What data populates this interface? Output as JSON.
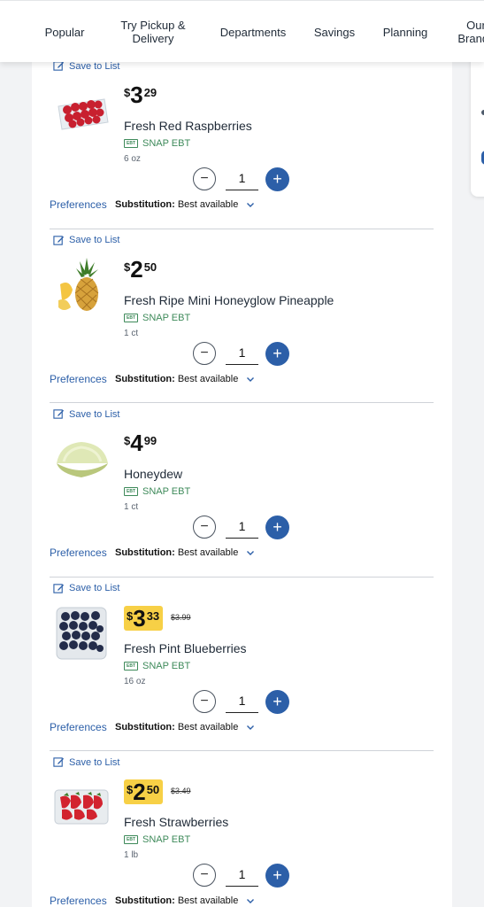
{
  "nav": {
    "items": [
      "Popular",
      "Try Pickup &\nDelivery",
      "Departments",
      "Savings",
      "Planning",
      "Our\nBrands"
    ]
  },
  "common": {
    "save_label": "Save to List",
    "snap_label": "SNAP EBT",
    "ebt_badge": "EBT",
    "preferences_label": "Preferences",
    "substitution_label": "Substitution:",
    "substitution_value": "Best available",
    "minus": "−",
    "plus": "+"
  },
  "colors": {
    "accent": "#2c5fa8",
    "snap_green": "#3e8a5a",
    "sale_yellow": "#f7d046"
  },
  "products": [
    {
      "name": "Fresh Red Raspberries",
      "currency": "$",
      "dollars": "3",
      "cents": "29",
      "sale": false,
      "original": "",
      "size": "6 oz",
      "qty": "1",
      "icon": "raspberries-icon"
    },
    {
      "name": "Fresh Ripe Mini Honeyglow Pineapple",
      "currency": "$",
      "dollars": "2",
      "cents": "50",
      "sale": false,
      "original": "",
      "size": "1 ct",
      "qty": "1",
      "icon": "pineapple-icon"
    },
    {
      "name": "Honeydew",
      "currency": "$",
      "dollars": "4",
      "cents": "99",
      "sale": false,
      "original": "",
      "size": "1 ct",
      "qty": "1",
      "icon": "honeydew-icon"
    },
    {
      "name": "Fresh Pint Blueberries",
      "currency": "$",
      "dollars": "3",
      "cents": "33",
      "sale": true,
      "original": "$3.99",
      "size": "16 oz",
      "qty": "1",
      "icon": "blueberries-icon"
    },
    {
      "name": "Fresh Strawberries",
      "currency": "$",
      "dollars": "2",
      "cents": "50",
      "sale": true,
      "original": "$3.49",
      "size": "1 lb",
      "qty": "1",
      "icon": "strawberries-icon"
    }
  ]
}
